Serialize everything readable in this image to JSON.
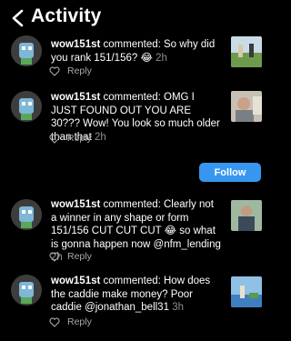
{
  "header": {
    "title": "Activity"
  },
  "follow_label": "Follow",
  "notifications": [
    {
      "username": "wow151st",
      "text": " commented: So why did you rank 151/156? 😂",
      "time": "2h",
      "reply_label": "Reply"
    },
    {
      "username": "wow151st",
      "text": " commented: OMG I JUST FOUND OUT YOU ARE 30??? Wow! You look so much older than that",
      "time": "2h",
      "reply_label": "Reply"
    },
    {
      "username": "wow151st",
      "text": " commented: Clearly not a winner in any shape or form 151/156 CUT CUT CUT 😂 so what is gonna happen now @nfm_lending",
      "time": "2h",
      "reply_label": "Reply"
    },
    {
      "username": "wow151st",
      "text": " commented: How does the caddie make money? Poor caddie @jonathan_bell31",
      "time": "3h",
      "reply_label": "Reply"
    }
  ],
  "colors": {
    "follow": "#3797f0",
    "background": "#000000",
    "secondary_text": "#8e8e8e"
  }
}
